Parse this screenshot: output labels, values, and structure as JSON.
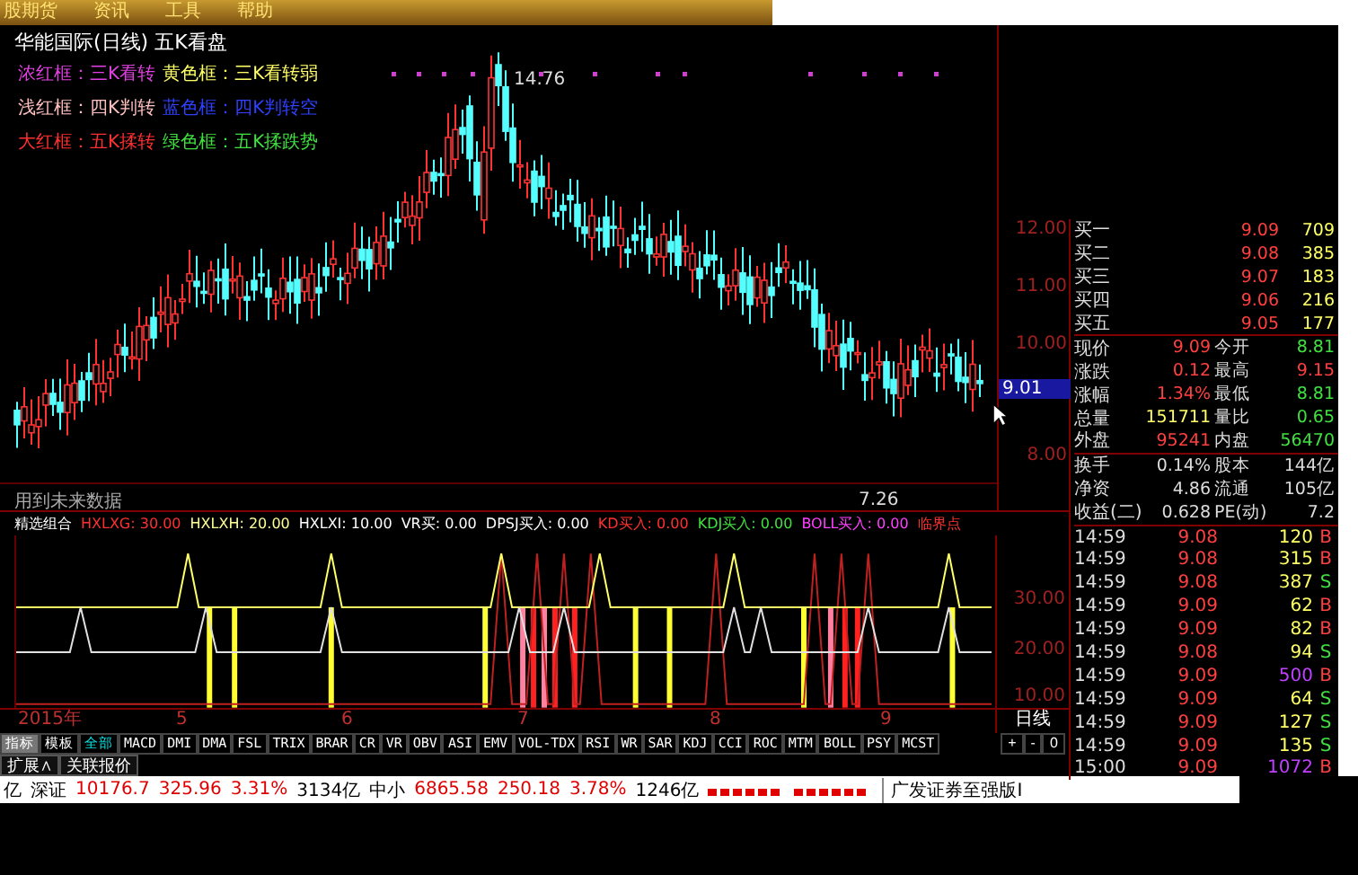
{
  "menu": [
    {
      "label": "股期货"
    },
    {
      "label": "资讯"
    },
    {
      "label": "工具"
    },
    {
      "label": "帮助"
    }
  ],
  "chart": {
    "title": "华能国际(日线) 五K看盘",
    "legend": [
      [
        {
          "text": "浓红框：三K看转",
          "color": "#e040e0"
        },
        {
          "text": "黄色框：三K看转弱",
          "color": "#ffff66"
        }
      ],
      [
        {
          "text": "浅红框：四K判转",
          "color": "#ffc0c0"
        },
        {
          "text": "蓝色框：四K判转空",
          "color": "#3040ff"
        }
      ],
      [
        {
          "text": "大红框：五K揉转",
          "color": "#ff3030"
        },
        {
          "text": "绿色框：五K揉跌势",
          "color": "#40e040"
        }
      ]
    ],
    "high_label": "14.76",
    "low_label": "7.26",
    "note": "用到未来数据",
    "yticks": [
      "12.00",
      "11.00",
      "10.00",
      "8.00"
    ],
    "current_price": "9.01"
  },
  "indicator": {
    "items": [
      {
        "text": "精选组合",
        "color": "#ffffff"
      },
      {
        "text": "HXLXG: 30.00",
        "color": "#ff3030"
      },
      {
        "text": "HXLXH: 20.00",
        "color": "#ffff99"
      },
      {
        "text": "HXLXI: 10.00",
        "color": "#ffffff"
      },
      {
        "text": "VR买: 0.00",
        "color": "#ffffff"
      },
      {
        "text": "DPSJ买入: 0.00",
        "color": "#ffffff"
      },
      {
        "text": "KD买入: 0.00",
        "color": "#ff3030"
      },
      {
        "text": "KDJ买入: 0.00",
        "color": "#40e040"
      },
      {
        "text": "BOLL买入: 0.00",
        "color": "#ff40ff"
      },
      {
        "text": "临界点",
        "color": "#ff3030"
      }
    ],
    "yticks": [
      "30.00",
      "20.00",
      "10.00"
    ]
  },
  "xaxis": [
    "2015年",
    "5",
    "6",
    "7",
    "8",
    "9"
  ],
  "period": "日线",
  "zoom_buttons": [
    "+",
    "-",
    "0"
  ],
  "tabs": [
    {
      "label": "指标",
      "selected": true,
      "kind": "panel"
    },
    {
      "label": "模板",
      "selected": false,
      "kind": "panel"
    },
    {
      "label": "全部",
      "selected": false,
      "kind": "all"
    },
    {
      "label": "MACD",
      "selected": false,
      "kind": "indicator"
    },
    {
      "label": "DMI",
      "selected": false,
      "kind": "indicator"
    },
    {
      "label": "DMA",
      "selected": false,
      "kind": "indicator"
    },
    {
      "label": "FSL",
      "selected": false,
      "kind": "indicator"
    },
    {
      "label": "TRIX",
      "selected": false,
      "kind": "indicator"
    },
    {
      "label": "BRAR",
      "selected": false,
      "kind": "indicator"
    },
    {
      "label": "CR",
      "selected": false,
      "kind": "indicator"
    },
    {
      "label": "VR",
      "selected": false,
      "kind": "indicator"
    },
    {
      "label": "OBV",
      "selected": false,
      "kind": "indicator"
    },
    {
      "label": "ASI",
      "selected": false,
      "kind": "indicator"
    },
    {
      "label": "EMV",
      "selected": false,
      "kind": "indicator"
    },
    {
      "label": "VOL-TDX",
      "selected": false,
      "kind": "indicator"
    },
    {
      "label": "RSI",
      "selected": false,
      "kind": "indicator"
    },
    {
      "label": "WR",
      "selected": false,
      "kind": "indicator"
    },
    {
      "label": "SAR",
      "selected": false,
      "kind": "indicator"
    },
    {
      "label": "KDJ",
      "selected": false,
      "kind": "indicator"
    },
    {
      "label": "CCI",
      "selected": false,
      "kind": "indicator"
    },
    {
      "label": "ROC",
      "selected": false,
      "kind": "indicator"
    },
    {
      "label": "MTM",
      "selected": false,
      "kind": "indicator"
    },
    {
      "label": "BOLL",
      "selected": false,
      "kind": "indicator"
    },
    {
      "label": "PSY",
      "selected": false,
      "kind": "indicator"
    },
    {
      "label": "MCST",
      "selected": false,
      "kind": "indicator"
    }
  ],
  "extra_buttons": [
    "扩展∧",
    "关联报价"
  ],
  "quote": {
    "bids": [
      {
        "label": "买一",
        "price": "9.09",
        "volume": "709"
      },
      {
        "label": "买二",
        "price": "9.08",
        "volume": "385"
      },
      {
        "label": "买三",
        "price": "9.07",
        "volume": "183"
      },
      {
        "label": "买四",
        "price": "9.06",
        "volume": "216"
      },
      {
        "label": "买五",
        "price": "9.05",
        "volume": "177"
      }
    ],
    "stats": [
      {
        "cells": [
          {
            "label": "现价",
            "value": "9.09",
            "color": "#ff4040"
          },
          {
            "label": "今开",
            "value": "8.81",
            "color": "#40e040"
          }
        ]
      },
      {
        "cells": [
          {
            "label": "涨跌",
            "value": "0.12",
            "color": "#ff4040"
          },
          {
            "label": "最高",
            "value": "9.15",
            "color": "#ff4040"
          }
        ]
      },
      {
        "cells": [
          {
            "label": "涨幅",
            "value": "1.34%",
            "color": "#ff4040"
          },
          {
            "label": "最低",
            "value": "8.81",
            "color": "#40e040"
          }
        ]
      },
      {
        "cells": [
          {
            "label": "总量",
            "value": "151711",
            "color": "#ffff66"
          },
          {
            "label": "量比",
            "value": "0.65",
            "color": "#40e040"
          }
        ]
      },
      {
        "cells": [
          {
            "label": "外盘",
            "value": "95241",
            "color": "#ff4040"
          },
          {
            "label": "内盘",
            "value": "56470",
            "color": "#40e040"
          }
        ]
      }
    ],
    "finance": [
      {
        "label": "换手",
        "value": "0.14%",
        "label2": "股本",
        "value2": "144亿"
      },
      {
        "label": "净资",
        "value": "4.86",
        "label2": "流通",
        "value2": "105亿"
      },
      {
        "label": "收益(二)",
        "value": "0.628",
        "label2": "PE(动)",
        "value2": "7.2"
      }
    ],
    "trades": [
      {
        "time": "14:59",
        "price": "9.08",
        "volume": "120",
        "side": "B",
        "big": false
      },
      {
        "time": "14:59",
        "price": "9.08",
        "volume": "315",
        "side": "B",
        "big": false
      },
      {
        "time": "14:59",
        "price": "9.08",
        "volume": "387",
        "side": "S",
        "big": false
      },
      {
        "time": "14:59",
        "price": "9.09",
        "volume": "62",
        "side": "B",
        "big": false
      },
      {
        "time": "14:59",
        "price": "9.09",
        "volume": "82",
        "side": "B",
        "big": false
      },
      {
        "time": "14:59",
        "price": "9.08",
        "volume": "94",
        "side": "S",
        "big": false
      },
      {
        "time": "14:59",
        "price": "9.09",
        "volume": "500",
        "side": "B",
        "big": true
      },
      {
        "time": "14:59",
        "price": "9.09",
        "volume": "64",
        "side": "S",
        "big": false
      },
      {
        "time": "14:59",
        "price": "9.09",
        "volume": "127",
        "side": "S",
        "big": false
      },
      {
        "time": "14:59",
        "price": "9.09",
        "volume": "135",
        "side": "S",
        "big": false
      },
      {
        "time": "15:00",
        "price": "9.09",
        "volume": "1072",
        "side": "B",
        "big": true
      }
    ]
  },
  "status_bar": [
    {
      "text": "亿",
      "color": "#000000"
    },
    {
      "text": "深证",
      "color": "#000000"
    },
    {
      "text": "10176.7",
      "color": "#e00000"
    },
    {
      "text": "325.96",
      "color": "#e00000"
    },
    {
      "text": "3.31%",
      "color": "#e00000"
    },
    {
      "text": "3134亿",
      "color": "#000000"
    },
    {
      "text": "中小",
      "color": "#000000"
    },
    {
      "text": "6865.58",
      "color": "#e00000"
    },
    {
      "text": "250.18",
      "color": "#e00000"
    },
    {
      "text": "3.78%",
      "color": "#e00000"
    },
    {
      "text": "1246亿",
      "color": "#000000"
    }
  ],
  "broker": "广发证券至强版I"
}
